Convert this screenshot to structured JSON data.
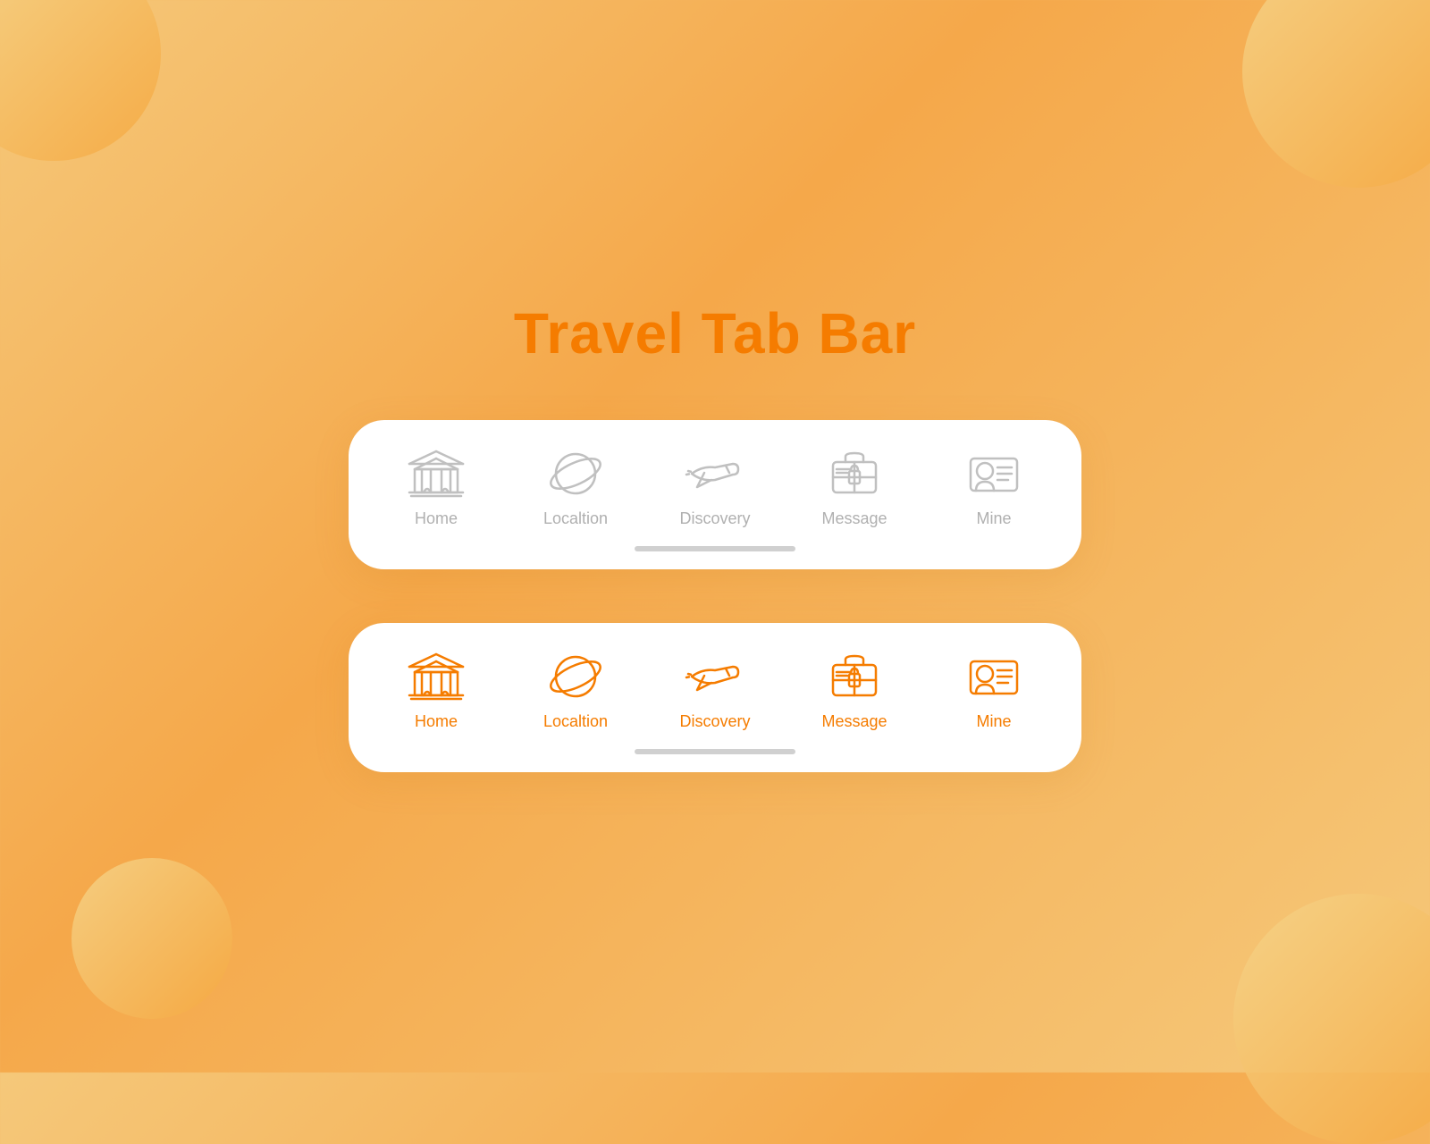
{
  "page": {
    "title": "Travel Tab Bar",
    "accent_color": "#f57c00",
    "inactive_color": "#c0c0c0",
    "label_inactive": "#b0b0b0"
  },
  "tab_bar_inactive": {
    "items": [
      {
        "id": "home",
        "label": "Home"
      },
      {
        "id": "location",
        "label": "Localtion"
      },
      {
        "id": "discovery",
        "label": "Discovery"
      },
      {
        "id": "message",
        "label": "Message"
      },
      {
        "id": "mine",
        "label": "Mine"
      }
    ]
  },
  "tab_bar_active": {
    "items": [
      {
        "id": "home",
        "label": "Home"
      },
      {
        "id": "location",
        "label": "Localtion"
      },
      {
        "id": "discovery",
        "label": "Discovery"
      },
      {
        "id": "message",
        "label": "Message"
      },
      {
        "id": "mine",
        "label": "Mine"
      }
    ]
  }
}
